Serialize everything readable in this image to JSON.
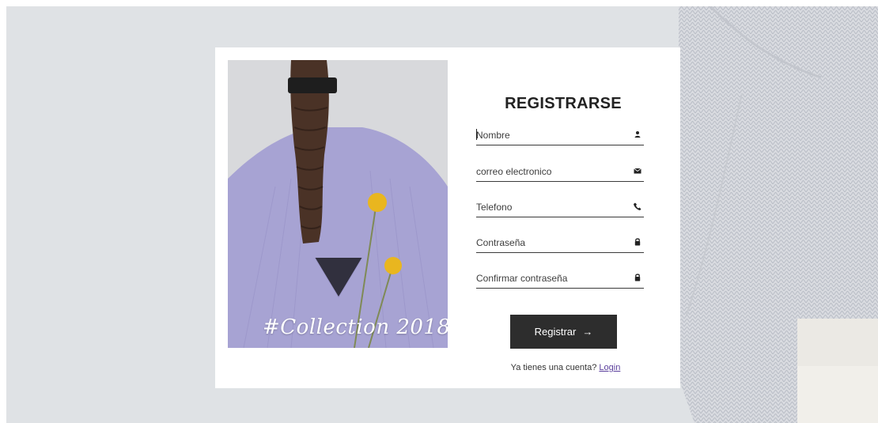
{
  "photo": {
    "caption": "#Collection 2018"
  },
  "form": {
    "title": "REGISTRARSE",
    "fields": [
      {
        "placeholder": "Nombre",
        "icon": "user-icon"
      },
      {
        "placeholder": "correo electronico",
        "icon": "envelope-icon"
      },
      {
        "placeholder": "Telefono",
        "icon": "phone-icon"
      },
      {
        "placeholder": "Contraseña",
        "icon": "lock-icon"
      },
      {
        "placeholder": "Confirmar contraseña",
        "icon": "lock-icon"
      }
    ],
    "submit_label": "Registrar",
    "submit_arrow": "→",
    "login_prompt": "Ya tienes una cuenta?",
    "login_link": "Login"
  },
  "colors": {
    "page_background": "#dfe2e5",
    "card_background": "#ffffff",
    "button_background": "#2d2d2d",
    "link": "#5b3f9c",
    "sweater": "#a7a3d3",
    "flower": "#e9b61f"
  }
}
